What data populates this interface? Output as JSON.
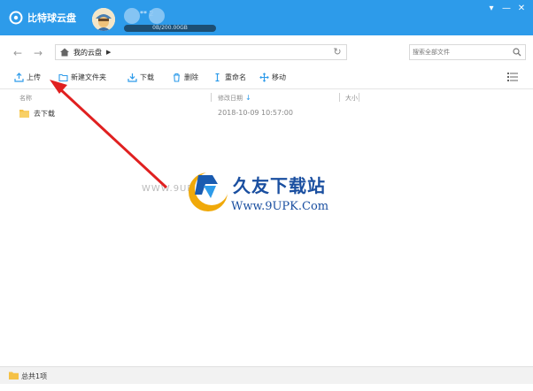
{
  "app": {
    "name": "比特球云盘",
    "user_extra": "** 2",
    "quota_text": "0B/200.00GB",
    "accent": "#2d9bea"
  },
  "window_controls": {
    "menu": "▾",
    "minimize": "—",
    "close": "✕"
  },
  "nav": {
    "back_icon": "arrow-left-icon",
    "forward_icon": "arrow-right-icon",
    "breadcrumb": "我的云盘",
    "search_placeholder": "搜索全部文件"
  },
  "toolbar": {
    "upload": "上传",
    "new_folder": "新建文件夹",
    "download": "下载",
    "delete": "删除",
    "rename": "重命名",
    "move": "移动"
  },
  "columns": {
    "name": "名称",
    "modified": "修改日期",
    "size": "大小",
    "sort_indicator": "↓"
  },
  "files": [
    {
      "name": "去下载",
      "modified": "2018-10-09 10:57:00",
      "size": ""
    }
  ],
  "watermark": {
    "title": "久友下载站",
    "url": "Www.9UPK.Com",
    "faint": "WWW.9UPK.COM"
  },
  "status": {
    "count_text": "总共1项"
  }
}
